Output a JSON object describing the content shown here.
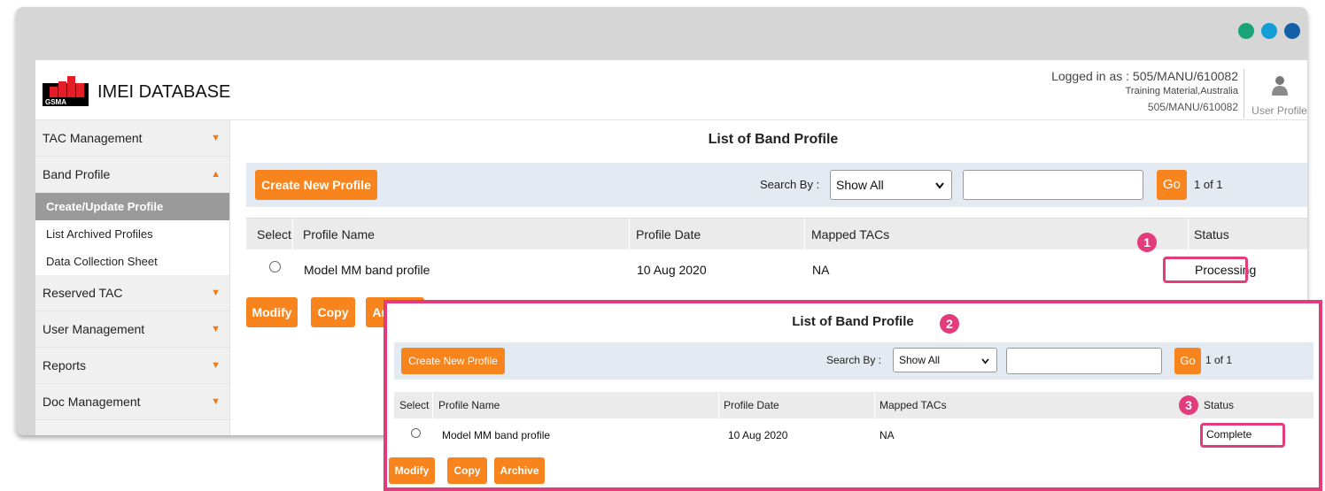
{
  "window": {
    "dot_colors": [
      "#1aa37a",
      "#139fd6",
      "#1460a6"
    ]
  },
  "header": {
    "brand_logo_text": "GSMA",
    "app_title": "IMEI DATABASE",
    "logged_in": "Logged in as : 505/MANU/610082",
    "org": "Training Material,Australia",
    "user_code": "505/MANU/610082",
    "user_profile_label": "User Profile"
  },
  "sidebar": {
    "items": [
      {
        "label": "TAC Management",
        "arrow": "▼"
      },
      {
        "label": "Band Profile",
        "arrow": "▲"
      },
      {
        "label": "Reserved TAC",
        "arrow": "▼"
      },
      {
        "label": "User Management",
        "arrow": "▼"
      },
      {
        "label": "Reports",
        "arrow": "▼"
      },
      {
        "label": "Doc Management",
        "arrow": "▼"
      }
    ],
    "sub_items": [
      "Create/Update Profile",
      "List Archived Profiles",
      "Data Collection Sheet"
    ]
  },
  "main": {
    "title": "List of Band Profile",
    "create_button": "Create New Profile",
    "search_label": "Search By :",
    "search_select": "Show All",
    "go_button": "Go",
    "page_info": "1 of 1",
    "columns": [
      "Select",
      "Profile Name",
      "Profile Date",
      "Mapped TACs",
      "Status"
    ],
    "row": {
      "profile_name": "Model MM band profile",
      "profile_date": "10 Aug 2020",
      "mapped_tacs": "NA",
      "status": "Processing"
    },
    "modify_button": "Modify",
    "copy_button": "Copy",
    "archive_button": "Archive"
  },
  "inset": {
    "title": "List of Band Profile",
    "create_button": "Create New Profile",
    "search_label": "Search By :",
    "search_select": "Show All",
    "go_button": "Go",
    "page_info": "1 of 1",
    "columns": [
      "Select",
      "Profile Name",
      "Profile Date",
      "Mapped TACs",
      "Status"
    ],
    "row": {
      "profile_name": "Model MM band profile",
      "profile_date": "10 Aug 2020",
      "mapped_tacs": "NA",
      "status": "Complete"
    },
    "modify_button": "Modify",
    "copy_button": "Copy",
    "archive_button": "Archive"
  },
  "callouts": [
    "1",
    "2",
    "3"
  ],
  "colors": {
    "accent": "#f7841c",
    "highlight": "#e23c7c",
    "toolbar_bg": "#e3eaf1"
  }
}
